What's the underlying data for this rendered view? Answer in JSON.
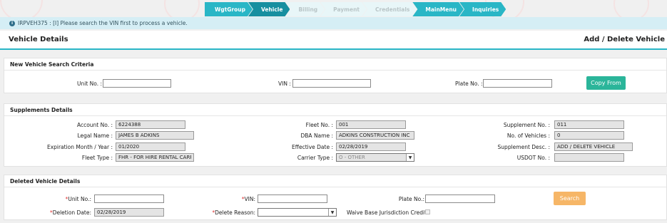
{
  "steps": [
    {
      "label": "WgtGroup",
      "state": "active"
    },
    {
      "label": "Vehicle",
      "state": "current"
    },
    {
      "label": "Billing",
      "state": "disabled"
    },
    {
      "label": "Payment",
      "state": "disabled"
    },
    {
      "label": "Credentials",
      "state": "disabled"
    },
    {
      "label": "MainMenu",
      "state": "active"
    },
    {
      "label": "Inquiries",
      "state": "active"
    }
  ],
  "info": {
    "icon": "info-icon",
    "message": "IRPVEH375 : [I] Please search the VIN first to process a vehicle."
  },
  "header": {
    "title": "Vehicle Details",
    "action_title": "Add / Delete Vehicle"
  },
  "search": {
    "heading": "New Vehicle Search Criteria",
    "unit_label": "Unit No. :",
    "unit_value": "",
    "vin_label": "VIN :",
    "vin_value": "",
    "plate_label": "Plate No. :",
    "plate_value": "",
    "copy_button": "Copy From"
  },
  "supplements": {
    "heading": "Supplements Details",
    "account_label": "Account No. :",
    "account_value": "6224388",
    "legal_label": "Legal Name :",
    "legal_value": "JAMES B ADKINS",
    "exp_label": "Expiration Month / Year :",
    "exp_value": "01/2020",
    "fleet_type_label": "Fleet Type :",
    "fleet_type_value": "FHR - FOR HIRE RENTAL CARRIE",
    "fleet_no_label": "Fleet No. :",
    "fleet_no_value": "001",
    "dba_label": "DBA Name :",
    "dba_value": "ADKINS CONSTRUCTION INC",
    "eff_label": "Effective Date :",
    "eff_value": "02/28/2019",
    "carrier_label": "Carrier Type :",
    "carrier_value": "O - OTHER",
    "supp_no_label": "Supplement No. :",
    "supp_no_value": "011",
    "num_veh_label": "No. of Vehicles :",
    "num_veh_value": "0",
    "supp_desc_label": "Supplement Desc. :",
    "supp_desc_value": "ADD / DELETE VEHICLE",
    "usdot_label": "USDOT No. :",
    "usdot_value": ""
  },
  "deleted": {
    "heading": "Deleted Vehicle Details",
    "unit_label": "Unit No.:",
    "unit_value": "",
    "vin_label": "VIN:",
    "vin_value": "",
    "plate_label": "Plate No.:",
    "plate_value": "",
    "search_button": "Search",
    "del_date_label": "Deletion Date:",
    "del_date_value": "02/28/2019",
    "reason_label": "Delete Reason:",
    "reason_value": "",
    "waive_label": "Waive Base Jurisdiction Credit:",
    "required_mark": "*"
  },
  "colors": {
    "accent": "#29b6c6",
    "copy_button": "#2bb59a",
    "search_button": "#f6b667"
  }
}
